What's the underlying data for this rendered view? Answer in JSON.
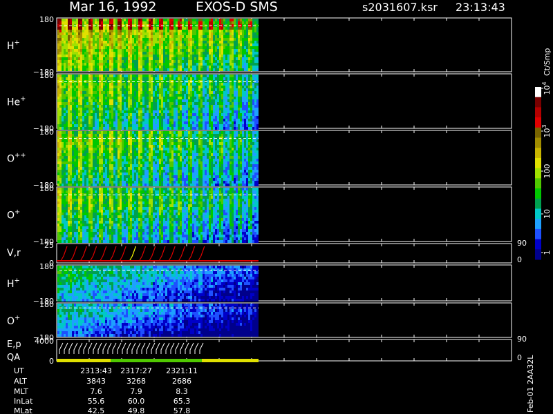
{
  "header": {
    "date": "Mar 16, 1992",
    "instrument": "EXOS-D SMS",
    "file": "s2031607.ksr",
    "time": "23:13:43"
  },
  "colorbar": {
    "unit": "Ct/Smp",
    "labels": [
      {
        "text": "1",
        "sup": ""
      },
      {
        "text": "10",
        "sup": ""
      },
      {
        "text": "100",
        "sup": ""
      },
      {
        "text": "10",
        "sup": "3"
      },
      {
        "text": "10",
        "sup": "4"
      }
    ],
    "colors": [
      "#00008b",
      "#0000c8",
      "#1e50ff",
      "#1ea0ff",
      "#00c8c8",
      "#00a050",
      "#00c800",
      "#50c800",
      "#a0e000",
      "#e0e000",
      "#c8b400",
      "#a08c00",
      "#786400",
      "#e00000",
      "#b40000",
      "#780000",
      "#ffffff"
    ]
  },
  "panels": [
    {
      "name": "H",
      "sup": "+",
      "top": "180",
      "bottom": "−180"
    },
    {
      "name": "He",
      "sup": "+",
      "top": "180",
      "bottom": "−180"
    },
    {
      "name": "O",
      "sup": "++",
      "top": "180",
      "bottom": "−180"
    },
    {
      "name": "O",
      "sup": "+",
      "top": "180",
      "bottom": "−180"
    },
    {
      "name": "V,r",
      "sup": "",
      "top": "25",
      "bottom": "0",
      "right_top": "90",
      "right_bottom": "0"
    },
    {
      "name": "H",
      "sup": "+",
      "top": "180",
      "bottom": "−180"
    },
    {
      "name": "O",
      "sup": "+",
      "top": "180",
      "bottom": "−180"
    },
    {
      "name": "E,p",
      "sup": "",
      "name2": "QA",
      "top": "4000",
      "bottom": "0",
      "right_top": "90",
      "right_bottom": "0"
    }
  ],
  "ephemeris": {
    "labels": [
      "UT",
      "ALT",
      "MLT",
      "InLat",
      "MLat"
    ],
    "columns": [
      [
        "2313:43",
        "3843",
        "7.6",
        "55.6",
        "42.5"
      ],
      [
        "2317:27",
        "3268",
        "7.9",
        "60.0",
        "49.8"
      ],
      [
        "2321:11",
        "2686",
        "8.3",
        "65.3",
        "57.8"
      ]
    ]
  },
  "footer_code": "Feb-01 2AA32L",
  "chart_data": {
    "type": "heatmap",
    "title": "Mar 16, 1992   EXOS-D SMS",
    "time_ticks": [
      "2313:43",
      "2317:27",
      "2321:11"
    ],
    "series": [
      {
        "name": "H+",
        "ylim": [
          -180,
          180
        ]
      },
      {
        "name": "He+",
        "ylim": [
          -180,
          180
        ]
      },
      {
        "name": "O++",
        "ylim": [
          -180,
          180
        ]
      },
      {
        "name": "O+",
        "ylim": [
          -180,
          180
        ]
      },
      {
        "name": "V,r",
        "ylim": [
          0,
          25
        ],
        "ylim_right": [
          0,
          90
        ]
      },
      {
        "name": "H+",
        "ylim": [
          -180,
          180
        ]
      },
      {
        "name": "O+",
        "ylim": [
          -180,
          180
        ]
      },
      {
        "name": "E,p",
        "ylim": [
          0,
          4000
        ],
        "ylim_right": [
          0,
          90
        ]
      }
    ],
    "colorscale": {
      "unit": "Ct/Smp",
      "range": [
        1,
        10000
      ],
      "scale": "log"
    }
  }
}
